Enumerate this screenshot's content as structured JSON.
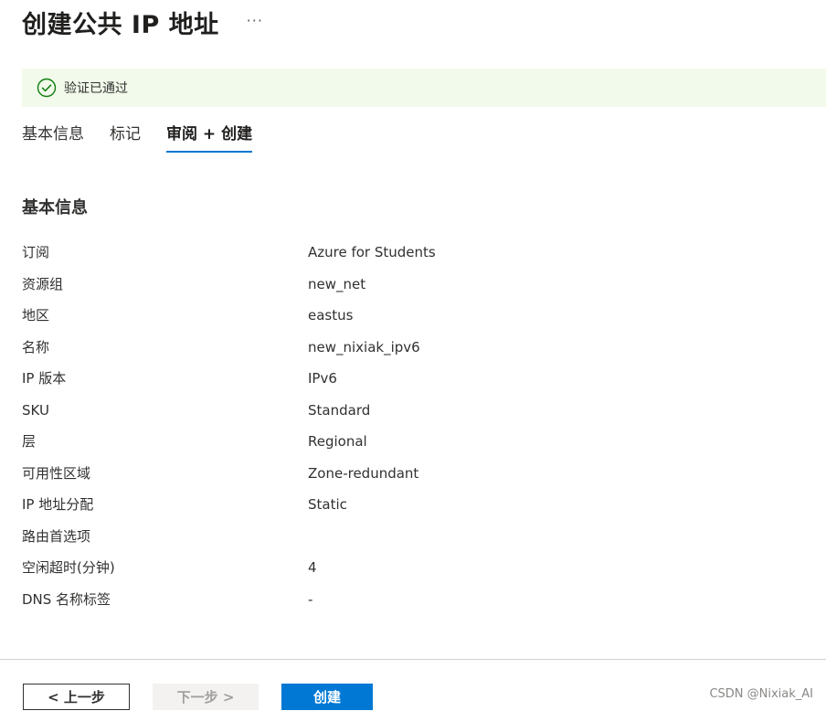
{
  "header": {
    "title": "创建公共 IP 地址",
    "more_label": "···"
  },
  "validation": {
    "text": "验证已通过",
    "icon": "check-circle-icon",
    "color": "#107c10"
  },
  "tabs": [
    {
      "label": "基本信息",
      "active": false
    },
    {
      "label": "标记",
      "active": false
    },
    {
      "label": "审阅 + 创建",
      "active": true
    }
  ],
  "section": {
    "title": "基本信息"
  },
  "properties": [
    {
      "label": "订阅",
      "value": "Azure for Students"
    },
    {
      "label": "资源组",
      "value": "new_net"
    },
    {
      "label": "地区",
      "value": "eastus"
    },
    {
      "label": "名称",
      "value": "new_nixiak_ipv6"
    },
    {
      "label": "IP 版本",
      "value": "IPv6"
    },
    {
      "label": "SKU",
      "value": "Standard"
    },
    {
      "label": "层",
      "value": "Regional"
    },
    {
      "label": "可用性区域",
      "value": "Zone-redundant"
    },
    {
      "label": "IP 地址分配",
      "value": "Static"
    },
    {
      "label": "路由首选项",
      "value": ""
    },
    {
      "label": "空闲超时(分钟)",
      "value": "4"
    },
    {
      "label": "DNS 名称标签",
      "value": "-"
    }
  ],
  "footer": {
    "prev_label": "< 上一步",
    "next_label": "下一步 >",
    "create_label": "创建"
  },
  "watermark": "CSDN @Nixiak_AI",
  "colors": {
    "accent": "#0078d4",
    "success_bg": "#f1faeb",
    "success": "#107c10"
  }
}
